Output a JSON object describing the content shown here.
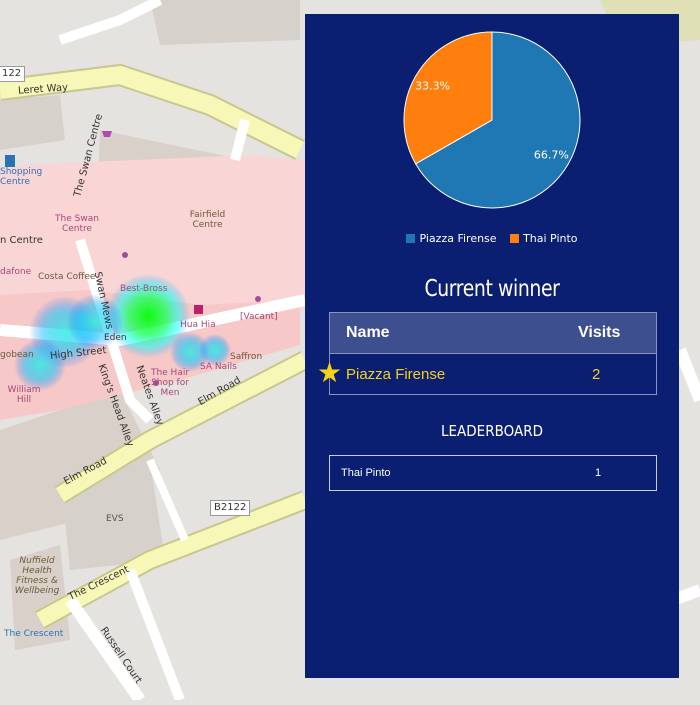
{
  "map": {
    "road_labels": [
      "Leret Way",
      "High Street",
      "Elm Road",
      "Elm Road",
      "The Crescent",
      "Russell Court",
      "King's Head Alley",
      "Neates Alley",
      "Swan Mews",
      "The Swan Centre",
      "Eden"
    ],
    "road_shields": [
      "122",
      "B2122"
    ],
    "place_labels": [
      "Shopping Centre",
      "The Swan Centre",
      "Fairfield Centre",
      "Costa Coffee",
      "Best-Bross",
      "Hua Hia",
      "[Vacant]",
      "Saffron",
      "The Hair Shop for Men",
      "SA Nails",
      "William Hill",
      "EVS",
      "Nuffield Health Fitness & Wellbeing",
      "The Crescent",
      "gobean",
      "n Centre",
      "dafone"
    ]
  },
  "chart_data": {
    "type": "pie",
    "slices": [
      {
        "label": "Piazza Firense",
        "value": 66.7,
        "display": "66.7%",
        "color": "#1f77b4"
      },
      {
        "label": "Thai Pinto",
        "value": 33.3,
        "display": "33.3%",
        "color": "#ff7f0e"
      }
    ],
    "legend": "bottom"
  },
  "winner": {
    "title": "Current winner",
    "col_name": "Name",
    "col_visits": "Visits",
    "name": "Piazza Firense",
    "visits": "2",
    "star_icon": "star-icon",
    "highlight_color": "#f4d21c"
  },
  "leaderboard": {
    "title": "LEADERBOARD",
    "rows": [
      {
        "name": "Thai Pinto",
        "visits": "1"
      }
    ]
  },
  "colors": {
    "panel": "#0b1f72",
    "pedestrian_zone": "#f9d5d5",
    "major_road": "#f7f7b8",
    "heat_blob": "#00ff40"
  }
}
